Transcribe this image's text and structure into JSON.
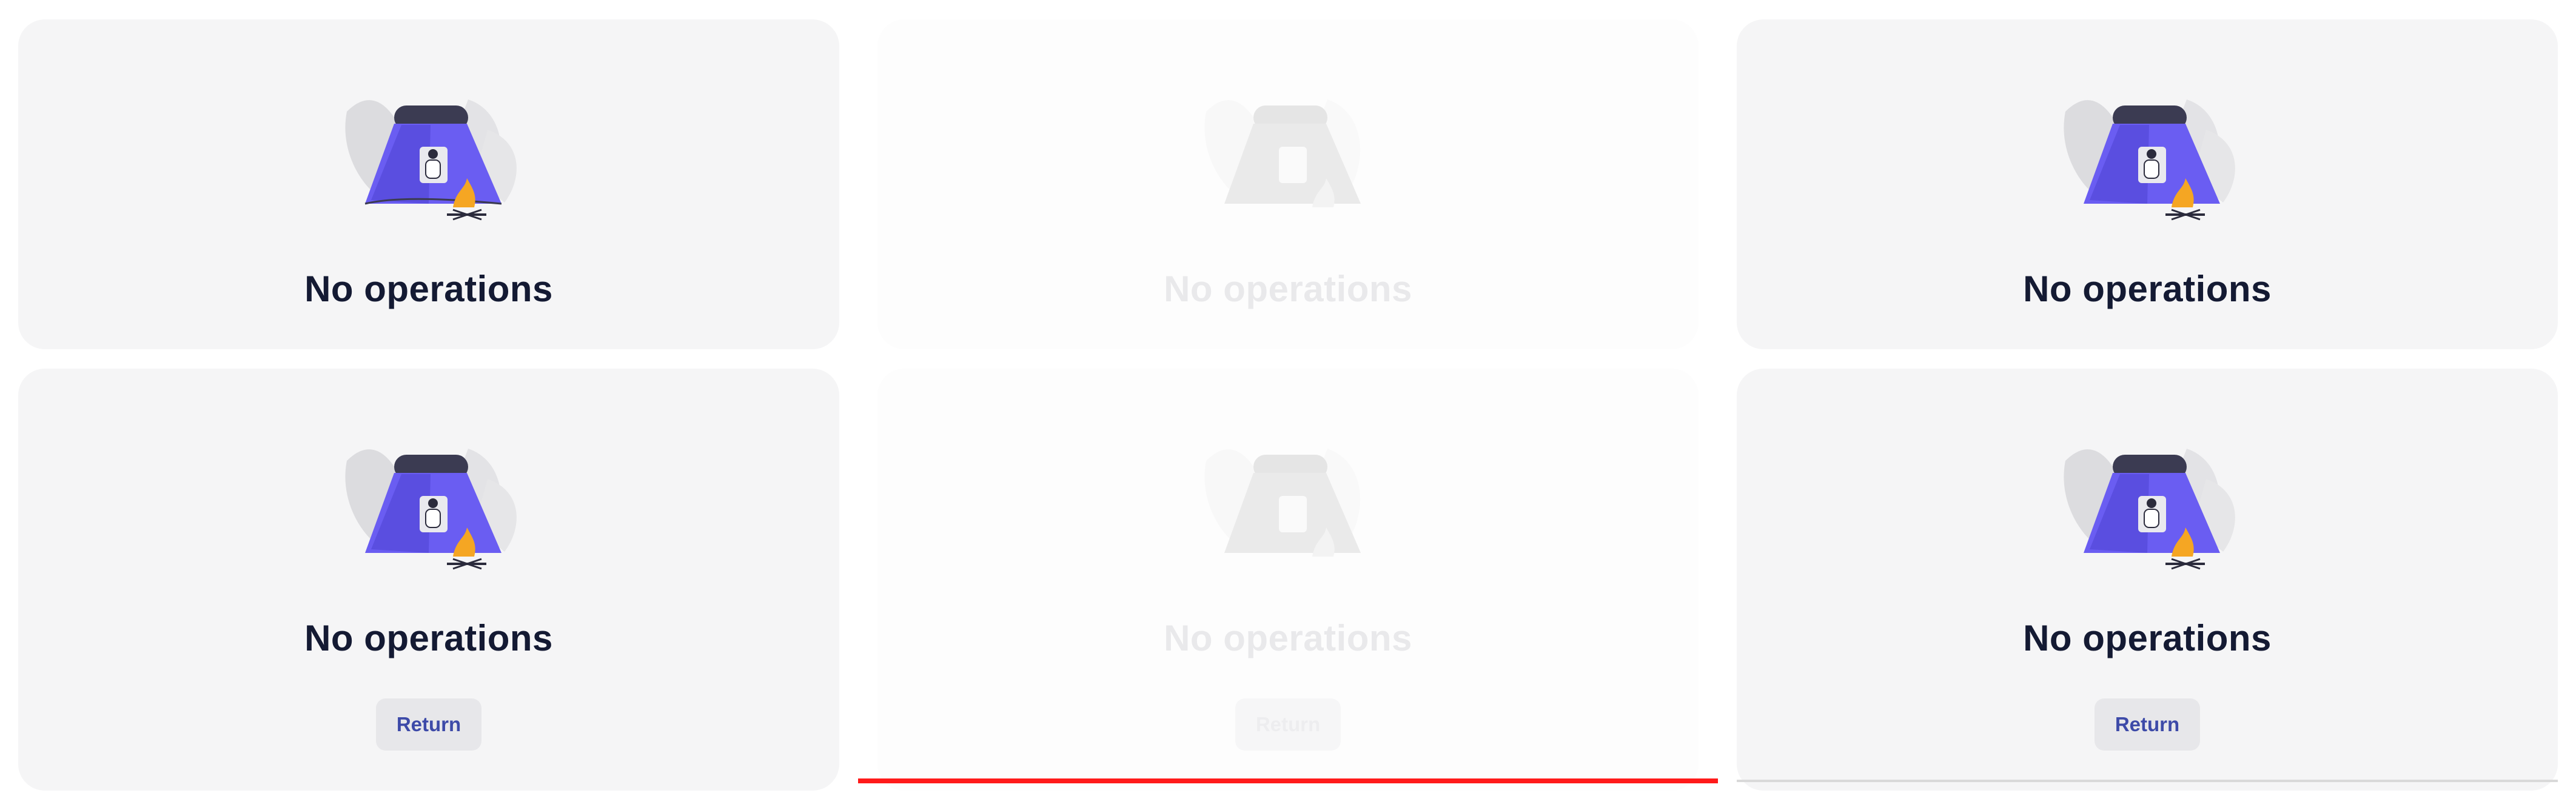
{
  "empty_state": {
    "title": "No operations",
    "return_label": "Return"
  },
  "colors": {
    "card_bg": "#f5f5f6",
    "title": "#141a33",
    "button_text": "#3d4aa8",
    "tent": "#6a5df2",
    "tent_top": "#3b3b52",
    "fire": "#f5a623",
    "progress_red": "#ff1a1a",
    "progress_gray": "#d9d9d9"
  },
  "icons": {
    "illustration": "camping-tent-illustration"
  }
}
